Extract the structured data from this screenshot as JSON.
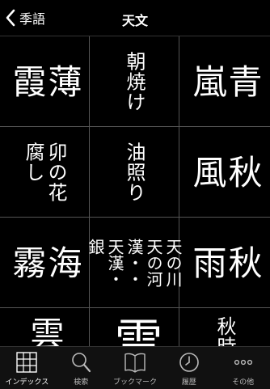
{
  "nav": {
    "back_label": "季語",
    "title": "天文"
  },
  "cells": [
    {
      "text": "薄\n霞",
      "size": "big"
    },
    {
      "text": "朝焼け",
      "size": "mid"
    },
    {
      "text": "青\n嵐",
      "size": "big"
    },
    {
      "text": "卯の花\n腐し",
      "size": "mid"
    },
    {
      "text": "油照り",
      "size": "mid"
    },
    {
      "text": "秋\n風",
      "size": "big"
    },
    {
      "text": "海\n霧",
      "size": "big"
    },
    {
      "text": "天の川\n天の河\n漢・・\n天漢・\n銀",
      "size": "sm"
    },
    {
      "text": "秋\n雨",
      "size": "big"
    },
    {
      "text": "雲",
      "size": "big"
    },
    {
      "text": "雲",
      "size": "big"
    },
    {
      "text": "秋時",
      "size": "mid"
    }
  ],
  "tabs": [
    {
      "label": "インデックス",
      "icon": "grid-icon",
      "active": true
    },
    {
      "label": "検索",
      "icon": "search-icon",
      "active": false
    },
    {
      "label": "ブックマーク",
      "icon": "book-icon",
      "active": false
    },
    {
      "label": "履歴",
      "icon": "clock-icon",
      "active": false
    },
    {
      "label": "その他",
      "icon": "more-icon",
      "active": false
    }
  ]
}
